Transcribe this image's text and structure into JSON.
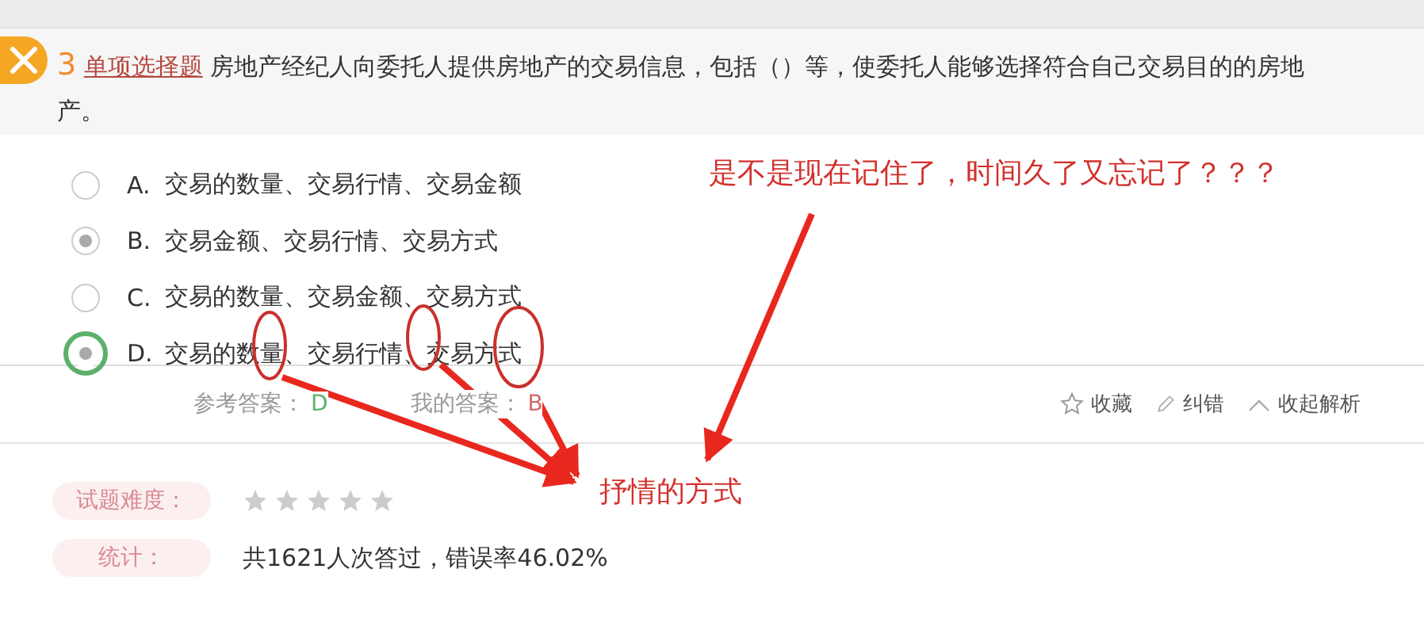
{
  "question": {
    "answered_correctly": false,
    "number": "3",
    "type": "单项选择题",
    "text": "房地产经纪人向委托人提供房地产的交易信息，包括（）等，使委托人能够选择符合自己交易目的的房地产。"
  },
  "options": [
    {
      "letter": "A.",
      "text": "交易的数量、交易行情、交易金额",
      "selected": false,
      "correct": false
    },
    {
      "letter": "B.",
      "text": "交易金额、交易行情、交易方式",
      "selected": true,
      "correct": false
    },
    {
      "letter": "C.",
      "text": "交易的数量、交易金额、交易方式",
      "selected": false,
      "correct": false
    },
    {
      "letter": "D.",
      "text": "交易的数量、交易行情、交易方式",
      "selected": true,
      "correct": true
    }
  ],
  "answers": {
    "reference_label": "参考答案：",
    "reference": "D",
    "mine_label": "我的答案：",
    "mine": "B"
  },
  "actions": [
    {
      "kind": "star",
      "label": "收藏"
    },
    {
      "kind": "pencil",
      "label": "纠错"
    },
    {
      "kind": "caret",
      "label": "收起解析"
    }
  ],
  "difficulty": {
    "label": "试题难度：",
    "stars": 0
  },
  "stats": {
    "label": "统计：",
    "text": "共1621人次答过，错误率46.02%"
  },
  "annotations": [
    {
      "text": "是不是现在记住了，时间久了又忘记了？？？"
    },
    {
      "text": "抒情的方式"
    }
  ]
}
